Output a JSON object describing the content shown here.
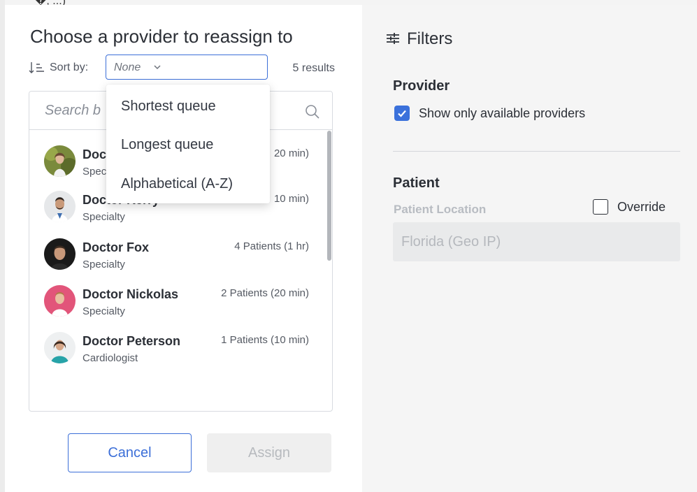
{
  "top_fragment": "�, ...)",
  "left": {
    "title": "Choose a provider to reassign to",
    "sort_label": "Sort by:",
    "sort_value": "None",
    "results": "5 results",
    "search_placeholder": "Search b",
    "providers": [
      {
        "name": "Doctor",
        "specialty": "Specialty",
        "queue": "20 min)"
      },
      {
        "name": "Doctor Kerry",
        "specialty": "Specialty",
        "queue": "10 min)"
      },
      {
        "name": "Doctor Fox",
        "specialty": "Specialty",
        "queue": "4 Patients (1 hr)"
      },
      {
        "name": "Doctor Nickolas",
        "specialty": "Specialty",
        "queue": "2 Patients (20 min)"
      },
      {
        "name": "Doctor Peterson",
        "specialty": "Cardiologist",
        "queue": "1 Patients (10 min)"
      }
    ],
    "cancel_label": "Cancel",
    "assign_label": "Assign"
  },
  "dropdown": {
    "options": [
      "Shortest queue",
      "Longest queue",
      "Alphabetical (A-Z)"
    ]
  },
  "filters": {
    "title": "Filters",
    "provider_section": "Provider",
    "available_label": "Show only available providers",
    "available_checked": true,
    "patient_section": "Patient",
    "location_label": "Patient Location",
    "override_label": "Override",
    "override_checked": false,
    "location_value": "Florida (Geo IP)"
  },
  "colors": {
    "accent": "#3c6fd8",
    "panel_bg": "#f5f5f5",
    "disabled_bg": "#efefef"
  },
  "icons": [
    "sort-icon",
    "chevron-down-icon",
    "search-icon",
    "filters-icon",
    "check-icon"
  ]
}
